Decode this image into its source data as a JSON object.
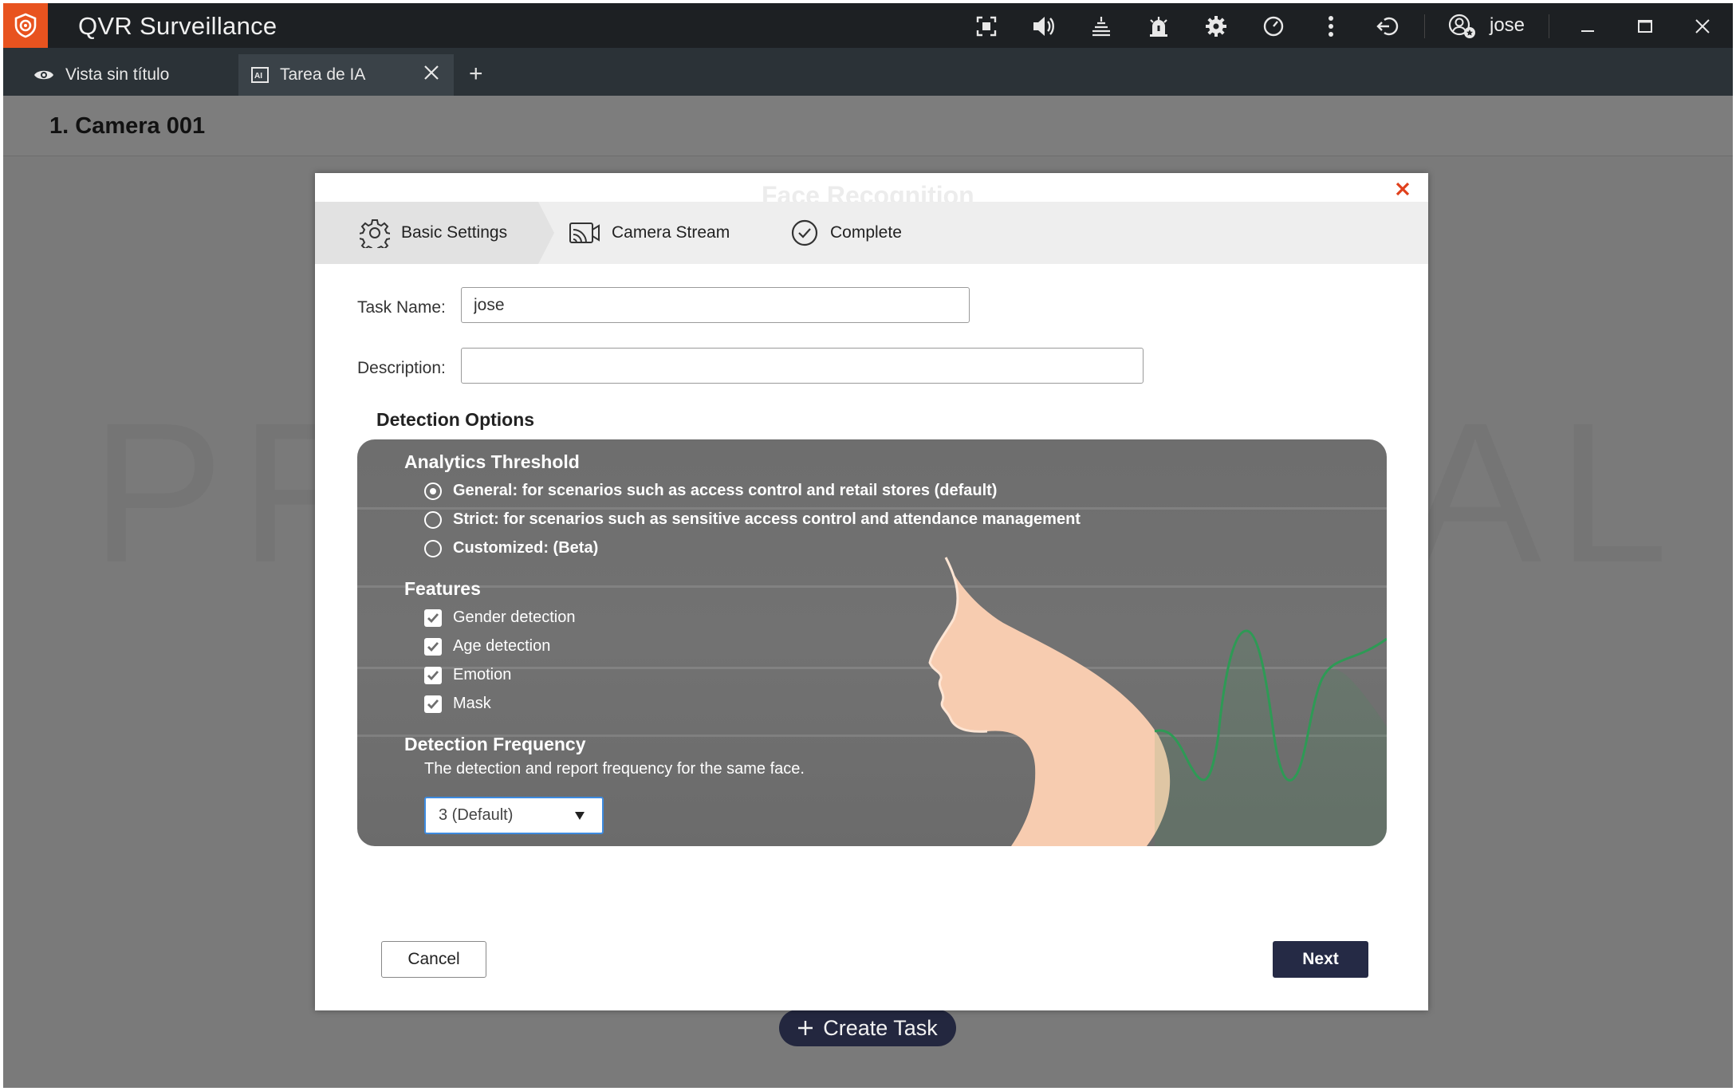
{
  "app": {
    "title": "QVR Surveillance",
    "user": "jose"
  },
  "tabs": [
    {
      "label": "Vista sin título"
    },
    {
      "label": "Tarea de IA"
    }
  ],
  "camera": {
    "title": "1. Camera 001"
  },
  "dialog": {
    "steps": [
      {
        "label": "Basic Settings"
      },
      {
        "label": "Camera Stream"
      },
      {
        "label": "Complete"
      }
    ],
    "task_name_label": "Task Name:",
    "task_name_value": "jose",
    "description_label": "Description:",
    "description_value": "",
    "detection_options_title": "Detection Options",
    "analytics_threshold": {
      "title": "Analytics Threshold",
      "options": [
        {
          "label": "General: for scenarios such as access control and retail stores (default)",
          "selected": true
        },
        {
          "label": "Strict: for scenarios such as sensitive access control and attendance management",
          "selected": false
        },
        {
          "label": "Customized: (Beta)",
          "selected": false
        }
      ]
    },
    "features": {
      "title": "Features",
      "items": [
        {
          "label": "Gender detection",
          "checked": true
        },
        {
          "label": "Age detection",
          "checked": true
        },
        {
          "label": "Emotion",
          "checked": true
        },
        {
          "label": "Mask",
          "checked": true
        }
      ]
    },
    "detection_frequency": {
      "title": "Detection Frequency",
      "description": "The detection and report frequency for the same face.",
      "selected": "3 (Default)"
    },
    "cancel_label": "Cancel",
    "next_label": "Next"
  },
  "create_task_label": "Create Task",
  "colors": {
    "brand": "#e8531f",
    "titlebar": "#1d2023",
    "primary_button": "#252a45",
    "close_red": "#e0401c",
    "wave_green": "#2e9a55"
  }
}
